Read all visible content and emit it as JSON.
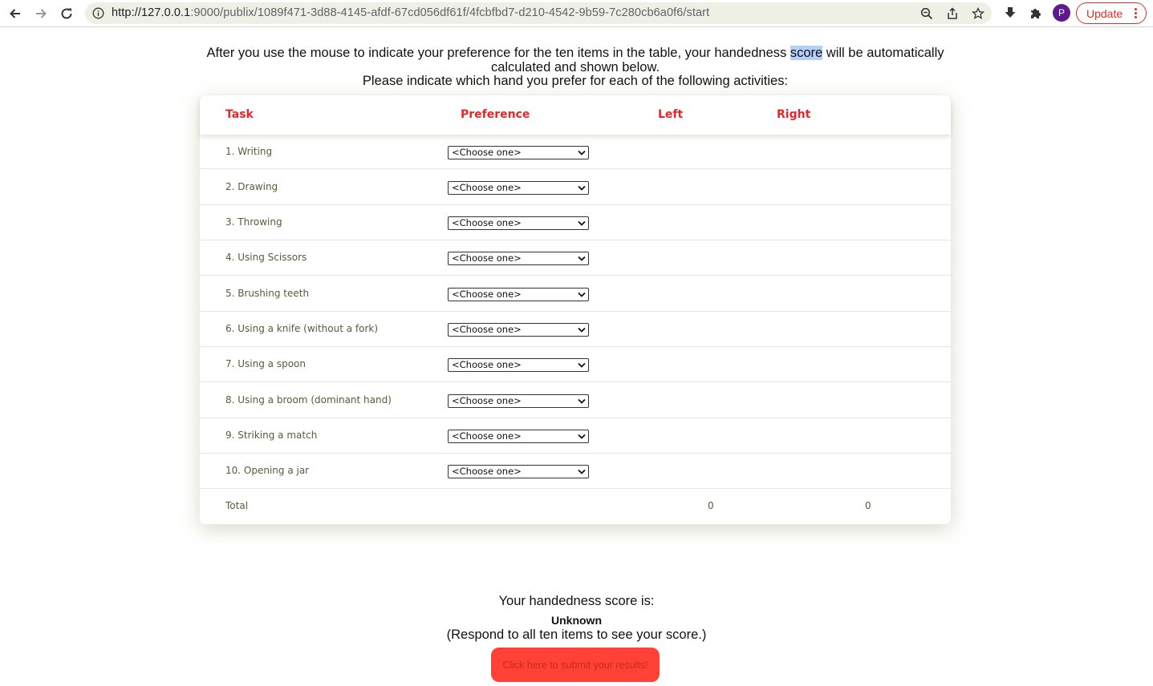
{
  "browser": {
    "url_host": "http://127.0.0.1",
    "url_rest": ":9000/publix/1089f471-3d88-4145-afdf-67cd056df61f/4fcbfbd7-d210-4542-9b59-7c280cb6a0f6/start",
    "avatar_letter": "P",
    "update_label": "Update"
  },
  "instructions": {
    "line1_before": "After you use the mouse to indicate your preference for the ten items in the table, your handedness ",
    "line1_highlight": "score",
    "line1_after": " will be automatically calculated and shown below.",
    "line2": "Please indicate which hand you prefer for each of the following activities:"
  },
  "table": {
    "headers": {
      "task": "Task",
      "preference": "Preference",
      "left": "Left",
      "right": "Right"
    },
    "rows": [
      {
        "task": "1. Writing",
        "selected": "<Choose one>"
      },
      {
        "task": "2. Drawing",
        "selected": "<Choose one>"
      },
      {
        "task": "3. Throwing",
        "selected": "<Choose one>"
      },
      {
        "task": "4. Using Scissors",
        "selected": "<Choose one>"
      },
      {
        "task": "5. Brushing teeth",
        "selected": "<Choose one>"
      },
      {
        "task": "6. Using a knife (without a fork)",
        "selected": "<Choose one>"
      },
      {
        "task": "7. Using a spoon",
        "selected": "<Choose one>"
      },
      {
        "task": "8. Using a broom (dominant hand)",
        "selected": "<Choose one>"
      },
      {
        "task": "9. Striking a match",
        "selected": "<Choose one>"
      },
      {
        "task": "10. Opening a jar",
        "selected": "<Choose one>"
      }
    ],
    "total": {
      "label": "Total",
      "left": "0",
      "right": "0"
    }
  },
  "score": {
    "title": "Your handedness score is:",
    "value": "Unknown",
    "note": "(Respond to all ten items to see your score.)",
    "submit_label": "Click here to submit your results!"
  },
  "colors": {
    "accent": "#e8262a",
    "submit_bg": "#ff4136",
    "update": "#d93025"
  }
}
